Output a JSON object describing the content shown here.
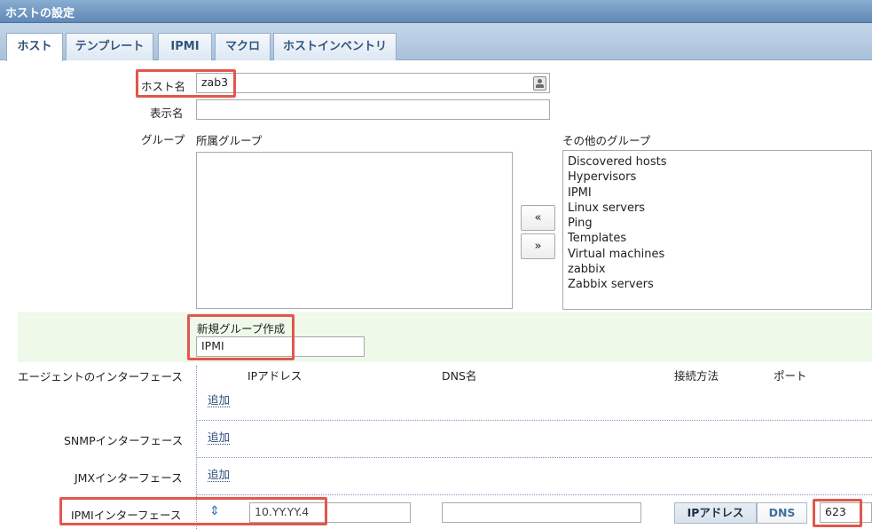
{
  "window": {
    "title": "ホストの設定"
  },
  "tabs": [
    {
      "label": "ホスト",
      "active": true
    },
    {
      "label": "テンプレート",
      "active": false
    },
    {
      "label": "IPMI",
      "active": false
    },
    {
      "label": "マクロ",
      "active": false
    },
    {
      "label": "ホストインベントリ",
      "active": false
    }
  ],
  "host": {
    "hostname_label": "ホスト名",
    "hostname_value": "zab3",
    "display_label": "表示名",
    "display_value": ""
  },
  "groups": {
    "label": "グループ",
    "member_label": "所属グループ",
    "other_label": "その他のグループ",
    "member_items": [],
    "other_items": [
      "Discovered hosts",
      "Hypervisors",
      "IPMI",
      "Linux servers",
      "Ping",
      "Templates",
      "Virtual machines",
      "zabbix",
      "Zabbix servers"
    ],
    "move_left": "«",
    "move_right": "»",
    "new_group_label": "新規グループ作成",
    "new_group_value": "IPMI"
  },
  "interfaces": {
    "agent_label": "エージェントのインターフェース",
    "headers": {
      "ip": "IPアドレス",
      "dns": "DNS名",
      "connect": "接続方法",
      "port": "ポート"
    },
    "add_link": "追加",
    "snmp_label": "SNMPインターフェース",
    "jmx_label": "JMXインターフェース",
    "ipmi_label": "IPMIインターフェース",
    "ipmi": {
      "ip_value": "10.YY.YY.4",
      "dns_value": "",
      "connect_ip": "IPアドレス",
      "connect_dns": "DNS",
      "port_value": "623"
    }
  },
  "colors": {
    "highlight": "#e2574c",
    "tab_text": "#33557d",
    "new_group_bg": "#eef9e9"
  },
  "icons": {
    "address_book": "address-book-icon",
    "drag": "drag-handle-icon"
  }
}
